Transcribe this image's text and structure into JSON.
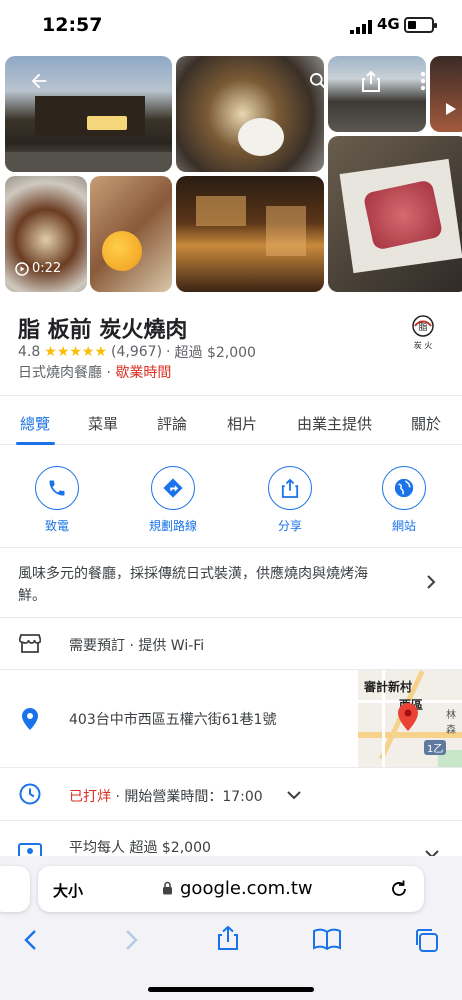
{
  "status_bar": {
    "time": "12:57",
    "network": "4G"
  },
  "photos": {
    "video_duration": "0:22"
  },
  "place": {
    "name": "脂 板前 炭火燒肉",
    "rating": "4.8",
    "stars": "★★★★★",
    "review_count": "(4,967)",
    "price": "超過 $2,000",
    "category": "日式燒肉餐廳",
    "hours_link": "歇業時間",
    "logo_text": "脂",
    "logo_sub": "炭 火"
  },
  "tabs": [
    "總覽",
    "菜單",
    "評論",
    "相片",
    "由業主提供",
    "關於"
  ],
  "actions": [
    {
      "label": "致電",
      "icon": "phone-icon"
    },
    {
      "label": "規劃路線",
      "icon": "directions-icon"
    },
    {
      "label": "分享",
      "icon": "share-icon"
    },
    {
      "label": "網站",
      "icon": "globe-icon"
    }
  ],
  "details": {
    "description": "風味多元的餐廳，採採傳統日式裝潢，供應燒肉與燒烤海鮮。",
    "description_line1": "風味多元的餐廳，採採傳統日式裝潢，供應燒肉與燒烤海",
    "description_line2": "鮮。",
    "amenities": "需要預訂 · 提供 Wi-Fi",
    "address": "403台中市西區五權六街61巷1號",
    "status_closed": "已打烊",
    "opening_time": "· 開始營業時間：17:00",
    "avg_price": "平均每人 超過 $2,000"
  },
  "map_thumb": {
    "label1": "審計新村",
    "label2": "西區",
    "label3": "林森",
    "road": "1乙"
  },
  "browser": {
    "text_size": "大小",
    "url": "google.com.tw"
  },
  "colors": {
    "accent": "#1a73e8",
    "closed_red": "#d93025",
    "star": "#fbbc04"
  }
}
